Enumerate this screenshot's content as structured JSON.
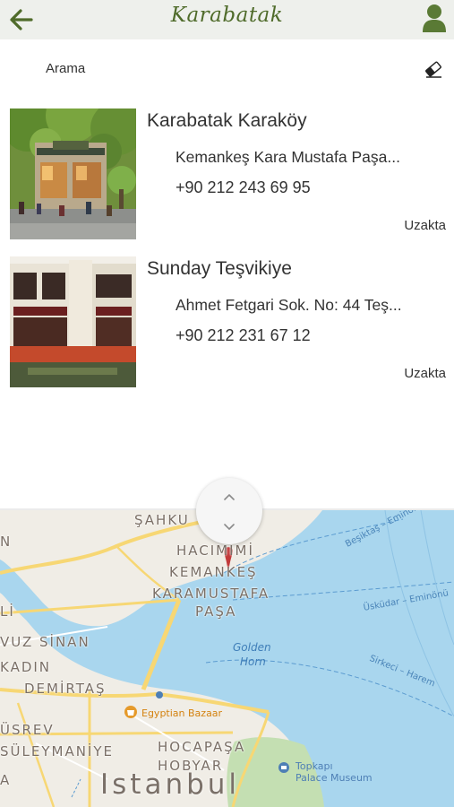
{
  "header": {
    "title": "Karabatak",
    "back_icon": "arrow-left-icon",
    "profile_icon": "user-icon",
    "background": "#eef0ec",
    "accent": "#4f6b2a"
  },
  "search": {
    "label": "Arama",
    "clear_icon": "eraser-icon"
  },
  "places": [
    {
      "name": "Karabatak Karaköy",
      "address": "Kemankeş Kara Mustafa Paşa...",
      "phone": "+90 212 243 69 95",
      "status": "Uzakta"
    },
    {
      "name": "Sunday Teşvikiye",
      "address": "Ahmet Fetgari Sok. No: 44 Teş...",
      "phone": "+90 212 231 67 12",
      "status": "Uzakta"
    }
  ],
  "toggle": {
    "up_icon": "chevron-up-icon",
    "down_icon": "chevron-down-icon"
  },
  "map": {
    "districts": [
      "ŞAHKU",
      "HACIMİMİ",
      "KEMANKEŞ",
      "KARAMUSTAFA",
      "PAŞA",
      "VUZ SİNAN",
      "KADIN",
      "DEMİRTAŞ",
      "ÜSREV",
      "SÜLEYMANİYE",
      "HOCAPAŞA",
      "HOBYAR",
      "N",
      "Lİ",
      "A"
    ],
    "water": [
      "Golden",
      "Horn"
    ],
    "ferries": [
      "Beşiktaş – Eminönü",
      "Üsküdar – Eminönü",
      "Sirkeci – Harem"
    ],
    "poi_bazaar": "Egyptian Bazaar",
    "poi_palace_1": "Topkapı",
    "poi_palace_2": "Palace Museum",
    "city": "Istanbul",
    "water_color": "#a9d6ee",
    "land_color": "#f0ede6",
    "park_color": "#c4dfb2",
    "road_color": "#f7d774"
  }
}
